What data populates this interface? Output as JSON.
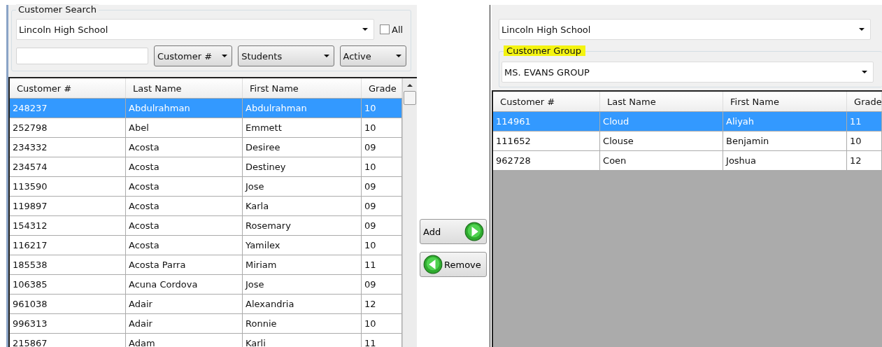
{
  "search_panel": {
    "legend": "Customer Search",
    "school_select": {
      "value": "Lincoln High School"
    },
    "all_checkbox": {
      "label": "All",
      "checked": false
    },
    "filters": [
      {
        "value": "Customer #"
      },
      {
        "value": "Students"
      },
      {
        "value": "Active"
      }
    ],
    "table": {
      "columns": [
        "Customer #",
        "Last Name",
        "First Name",
        "Grade"
      ],
      "rows": [
        {
          "cells": [
            "248237",
            "Abdulrahman",
            "Abdulrahman",
            "10"
          ],
          "selected": true
        },
        {
          "cells": [
            "252798",
            "Abel",
            "Emmett",
            "10"
          ],
          "selected": false
        },
        {
          "cells": [
            "234332",
            "Acosta",
            "Desiree",
            "09"
          ],
          "selected": false
        },
        {
          "cells": [
            "234574",
            "Acosta",
            "Destiney",
            "10"
          ],
          "selected": false
        },
        {
          "cells": [
            "113590",
            "Acosta",
            "Jose",
            "09"
          ],
          "selected": false
        },
        {
          "cells": [
            "119897",
            "Acosta",
            "Karla",
            "09"
          ],
          "selected": false
        },
        {
          "cells": [
            "154312",
            "Acosta",
            "Rosemary",
            "09"
          ],
          "selected": false
        },
        {
          "cells": [
            "116217",
            "Acosta",
            "Yamilex",
            "10"
          ],
          "selected": false
        },
        {
          "cells": [
            "185538",
            "Acosta Parra",
            "Miriam",
            "11"
          ],
          "selected": false
        },
        {
          "cells": [
            "106385",
            "Acuna Cordova",
            "Jose",
            "09"
          ],
          "selected": false
        },
        {
          "cells": [
            "961038",
            "Adair",
            "Alexandria",
            "12"
          ],
          "selected": false
        },
        {
          "cells": [
            "996313",
            "Adair",
            "Ronnie",
            "10"
          ],
          "selected": false
        },
        {
          "cells": [
            "215867",
            "Adam",
            "Karli",
            "11"
          ],
          "selected": false
        }
      ]
    }
  },
  "buttons": [
    {
      "label": "Add",
      "kind": "add"
    },
    {
      "label": "Remove",
      "kind": "remove"
    }
  ],
  "group_panel": {
    "school_select": {
      "value": "Lincoln High School"
    },
    "group": {
      "legend": "Customer Group",
      "highlighted": true,
      "select": {
        "value": "MS. EVANS GROUP"
      }
    },
    "table": {
      "columns": [
        "Customer #",
        "Last Name",
        "First Name",
        "Grade"
      ],
      "rows": [
        {
          "cells": [
            "114961",
            "Cloud",
            "Aliyah",
            "11"
          ],
          "selected": true
        },
        {
          "cells": [
            "111652",
            "Clouse",
            "Benjamin",
            "10"
          ],
          "selected": false
        },
        {
          "cells": [
            "962728",
            "Coen",
            "Joshua",
            "12"
          ],
          "selected": false
        }
      ]
    }
  }
}
